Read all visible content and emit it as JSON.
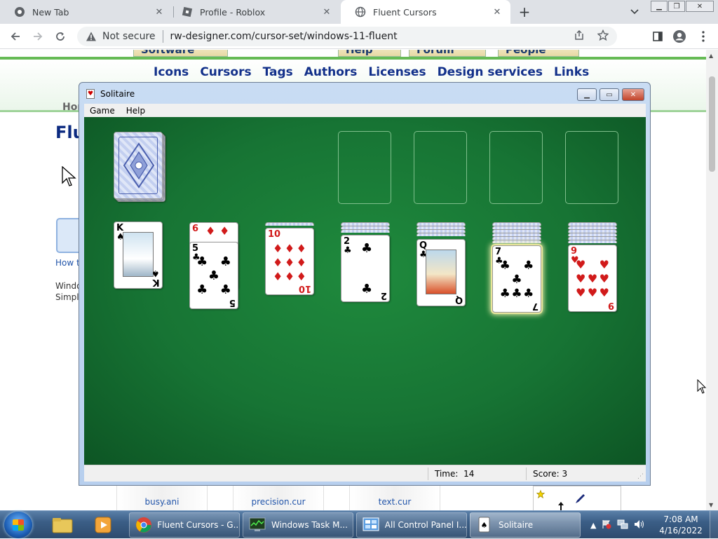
{
  "browser": {
    "tabs": [
      {
        "title": "New Tab",
        "icon": "chrome-icon"
      },
      {
        "title": "Profile - Roblox",
        "icon": "roblox-icon"
      },
      {
        "title": "Fluent Cursors",
        "icon": "globe-icon",
        "active": true
      }
    ],
    "security_label": "Not secure",
    "url": "rw-designer.com/cursor-set/windows-11-fluent"
  },
  "page": {
    "site_tabs": [
      "Software",
      "Help",
      "Forum",
      "People"
    ],
    "nav_links": [
      "Icons",
      "Cursors",
      "Tags",
      "Authors",
      "Licenses",
      "Design services",
      "Links"
    ],
    "breadcrumb": "Hom",
    "heading": "Flu",
    "howto_text": "How t",
    "body_text_1": "Windo",
    "body_text_2": "Simple",
    "bottom_files": [
      "busy.ani",
      "precision.cur",
      "text.cur"
    ]
  },
  "solitaire": {
    "title": "Solitaire",
    "menu": [
      "Game",
      "Help"
    ],
    "time_label": "Time:",
    "time_value": "14",
    "score_label": "Score:",
    "score_value": "3",
    "tableau": [
      {
        "rank": "K",
        "suit": "♠",
        "color": "black",
        "face": true
      },
      {
        "under_rank": "6",
        "under_suit": "♦",
        "rank": "5",
        "suit": "♣",
        "color": "black"
      },
      {
        "rank": "10",
        "suit": "♦",
        "color": "red"
      },
      {
        "rank": "2",
        "suit": "♣",
        "color": "black"
      },
      {
        "rank": "Q",
        "suit": "♣",
        "color": "black",
        "face": true
      },
      {
        "rank": "7",
        "suit": "♣",
        "color": "black",
        "selected": true
      },
      {
        "rank": "9",
        "suit": "♥",
        "color": "red"
      }
    ],
    "colors": {
      "felt": "#177434",
      "window": "#c9dcf3"
    }
  },
  "taskbar": {
    "buttons": [
      {
        "label": "Fluent Cursors - G...",
        "icon": "chrome-icon"
      },
      {
        "label": "Windows Task M...",
        "icon": "task-manager-icon"
      },
      {
        "label": "All Control Panel I...",
        "icon": "control-panel-icon"
      },
      {
        "label": "Solitaire",
        "icon": "solitaire-icon",
        "active": true
      }
    ],
    "time": "7:08 AM",
    "date": "4/16/2022"
  }
}
